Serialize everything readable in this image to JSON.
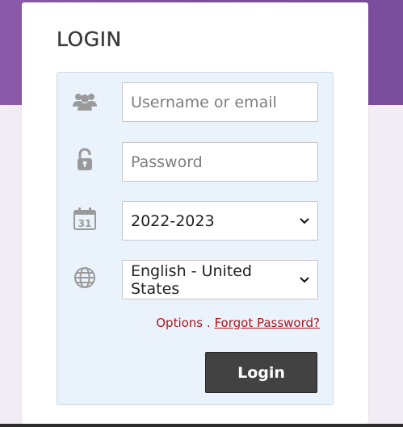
{
  "login": {
    "title": "LOGIN",
    "username": {
      "value": "",
      "placeholder": "Username or email",
      "icon": "users-icon"
    },
    "password": {
      "value": "",
      "placeholder": "Password",
      "icon": "lock-icon"
    },
    "school_year": {
      "selected": "2022-2023",
      "icon": "calendar-icon",
      "calendar_day": "31"
    },
    "language": {
      "selected": "English - United States",
      "icon": "globe-icon"
    },
    "options_label": "Options",
    "separator": " . ",
    "forgot_password_label": "Forgot Password?",
    "submit_label": "Login"
  },
  "colors": {
    "header_purple": "#7e4fa0",
    "panel_blue": "#eaf3fb",
    "link_red": "#b5121b",
    "button_dark": "#424242",
    "icon_gray": "#9a9a9a"
  }
}
